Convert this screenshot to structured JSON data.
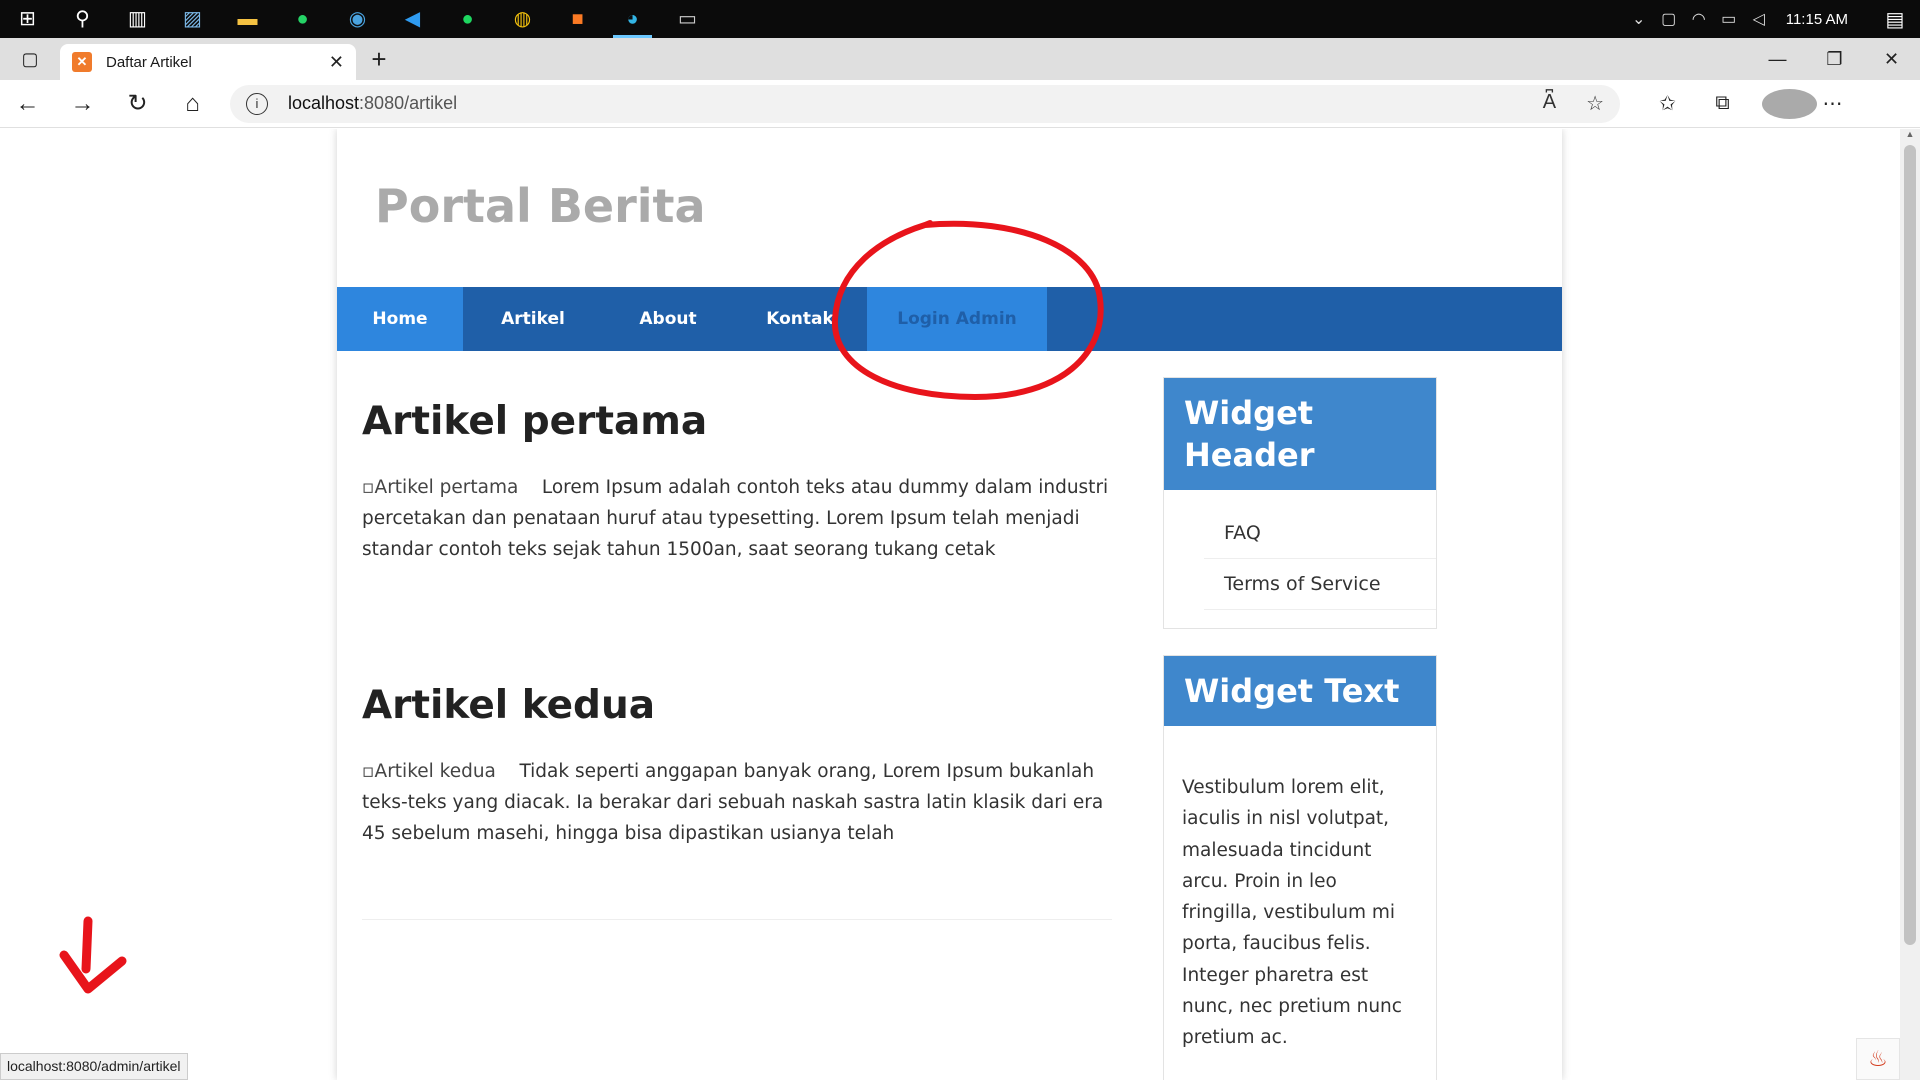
{
  "taskbar": {
    "icons": [
      "windows-icon",
      "search-icon",
      "task-view-icon",
      "photos-icon",
      "file-explorer-icon",
      "whatsapp-icon",
      "edge-dev-icon",
      "vscode-icon",
      "spotify-icon",
      "chrome-icon",
      "xampp-icon",
      "edge-icon",
      "terminal-icon"
    ],
    "time": "11:15 AM"
  },
  "browser": {
    "tab_title": "Daftar Artikel",
    "url_host": "localhost",
    "url_path": ":8080/artikel",
    "status_link": "localhost:8080/admin/artikel"
  },
  "site": {
    "title": "Portal Berita",
    "nav": {
      "home": "Home",
      "artikel": "Artikel",
      "about": "About",
      "kontak": "Kontak",
      "login_admin": "Login Admin"
    },
    "articles": [
      {
        "title": "Artikel pertama",
        "image_alt": "Artikel pertama",
        "body": "Lorem Ipsum adalah contoh teks atau dummy dalam industri percetakan dan penataan huruf atau typesetting. Lorem Ipsum telah menjadi standar contoh teks sejak tahun 1500an, saat seorang tukang cetak"
      },
      {
        "title": "Artikel kedua",
        "image_alt": "Artikel kedua",
        "body": "Tidak seperti anggapan banyak orang, Lorem Ipsum bukanlah teks-teks yang diacak. Ia berakar dari sebuah naskah sastra latin klasik dari era 45 sebelum masehi, hingga bisa dipastikan usianya telah"
      }
    ],
    "widget_header": {
      "title": "Widget Header",
      "links": [
        "FAQ",
        "Terms of Service"
      ]
    },
    "widget_text": {
      "title": "Widget Text",
      "body": "Vestibulum lorem elit, iaculis in nisl volutpat, malesuada tincidunt arcu. Proin in leo fringilla, vestibulum mi porta, faucibus felis. Integer pharetra est nunc, nec pretium nunc pretium ac."
    }
  },
  "colors": {
    "nav_bg": "#1f5fa8",
    "nav_active": "#2e86de",
    "widget_head": "#3f87cc",
    "annotation_red": "#e8141b"
  }
}
